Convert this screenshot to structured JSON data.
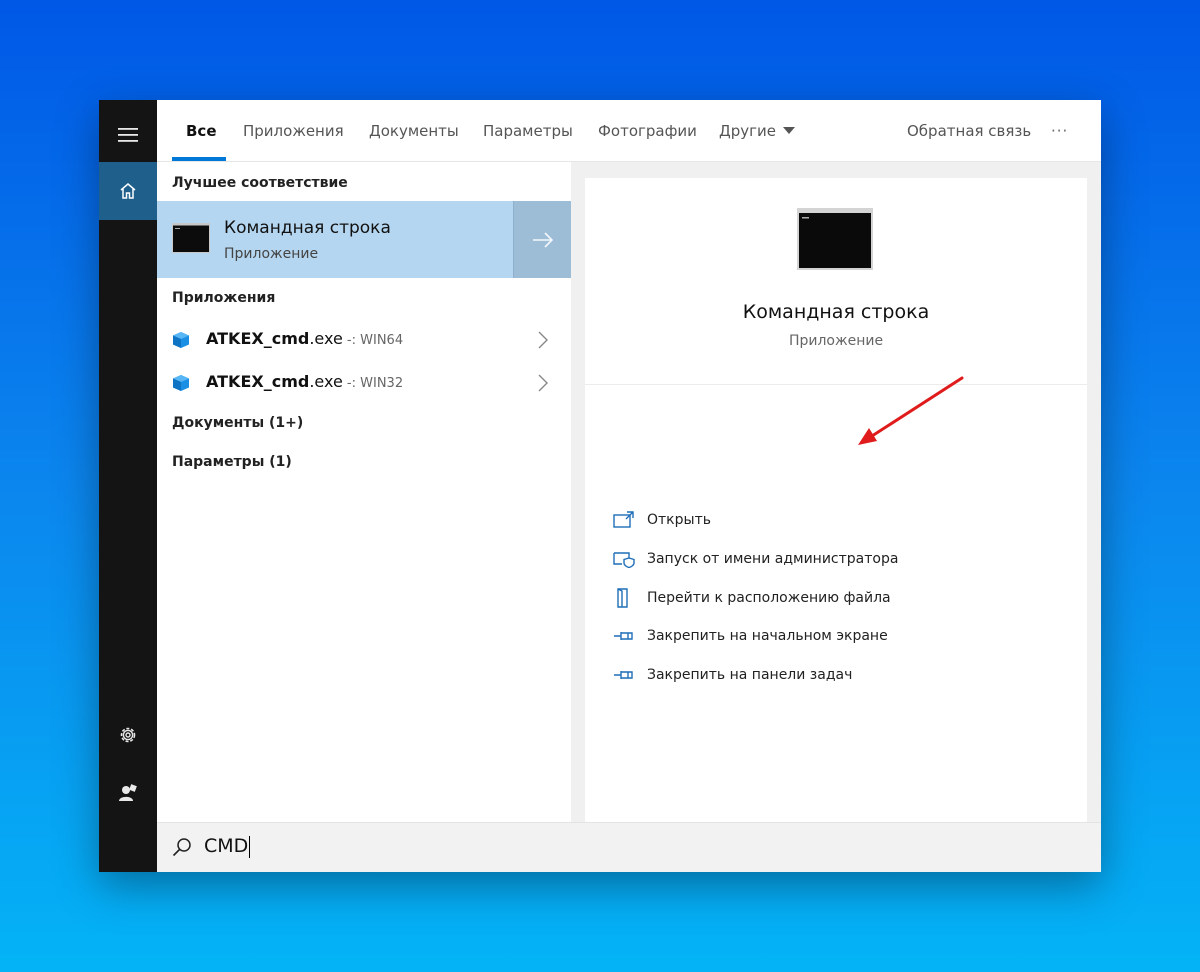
{
  "tabs": [
    {
      "label": "Все",
      "active": true
    },
    {
      "label": "Приложения"
    },
    {
      "label": "Документы"
    },
    {
      "label": "Параметры"
    },
    {
      "label": "Фотографии"
    },
    {
      "label": "Другие"
    }
  ],
  "feedback_label": "Обратная связь",
  "more_label": "···",
  "results": {
    "best_match_heading": "Лучшее соответствие",
    "best_match": {
      "title": "Командная строка",
      "subtitle": "Приложение"
    },
    "apps_heading": "Приложения",
    "apps": [
      {
        "name_bold": "ATKEX_cmd",
        "name_rest": ".exe",
        "suffix": " -: WIN64"
      },
      {
        "name_bold": "ATKEX_cmd",
        "name_rest": ".exe",
        "suffix": " -: WIN32"
      }
    ],
    "documents_heading": "Документы (1+)",
    "settings_heading": "Параметры (1)"
  },
  "details": {
    "title": "Командная строка",
    "subtitle": "Приложение",
    "actions": [
      {
        "label": "Открыть",
        "icon": "open-icon"
      },
      {
        "label": "Запуск от имени администратора",
        "icon": "shield-icon"
      },
      {
        "label": "Перейти к расположению файла",
        "icon": "file-location-icon"
      },
      {
        "label": "Закрепить на начальном экране",
        "icon": "pin-icon"
      },
      {
        "label": "Закрепить на панели задач",
        "icon": "pin-icon"
      }
    ]
  },
  "search": {
    "value": "CMD"
  },
  "colors": {
    "accent": "#0078d7",
    "selection": "#b5d6f0",
    "annotation_arrow": "#e01b1b"
  }
}
